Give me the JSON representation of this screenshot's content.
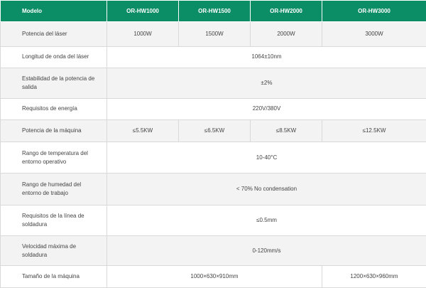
{
  "table": {
    "header": {
      "label": "Modelo",
      "models": [
        "OR-HW1000",
        "OR-HW1500",
        "OR-HW2000",
        "OR-HW3000"
      ]
    },
    "rows": [
      {
        "label": "Potencia del láser",
        "cells": [
          "1000W",
          "1500W",
          "2000W",
          "3000W"
        ]
      },
      {
        "label": "Longitud de onda del láser",
        "value": "1064±10nm"
      },
      {
        "label": "Estabilidad de la potencia de salida",
        "value": "±2%"
      },
      {
        "label": "Requisitos de energía",
        "value": "220V/380V"
      },
      {
        "label": "Potencia de la máquina",
        "cells": [
          "≤5.5KW",
          "≤6.5KW",
          "≤8.5KW",
          "≤12.5KW"
        ]
      },
      {
        "label": "Rango de temperatura del entorno operativo",
        "value": "10-40°C"
      },
      {
        "label": "Rango de humedad del entorno de trabajo",
        "value": "< 70% No condensation"
      },
      {
        "label": "Requisitos de la línea de soldadura",
        "value": "≤0.5mm"
      },
      {
        "label": "Velocidad máxima de soldadura",
        "value": "0-120mm/s"
      },
      {
        "label": "Tamaño de la máquina",
        "cells": [
          "1000×630×910mm",
          "1200×630×960mm"
        ]
      }
    ]
  }
}
